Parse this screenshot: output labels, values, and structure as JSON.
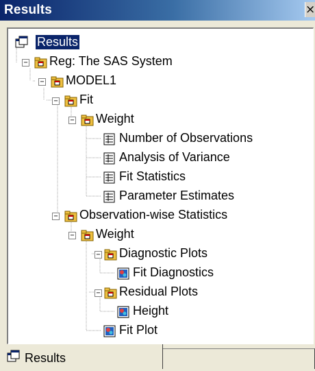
{
  "window": {
    "title": "Results",
    "close_glyph": "×"
  },
  "tree": {
    "root": "Results",
    "reg": "Reg:  The SAS System",
    "model": "MODEL1",
    "fit": "Fit",
    "fit_weight": "Weight",
    "number_of_observations": "Number of Observations",
    "analysis_of_variance": "Analysis of Variance",
    "fit_statistics": "Fit Statistics",
    "parameter_estimates": "Parameter Estimates",
    "observation_wise": "Observation-wise Statistics",
    "obs_weight": "Weight",
    "diagnostic_plots": "Diagnostic Plots",
    "fit_diagnostics": "Fit Diagnostics",
    "residual_plots": "Residual Plots",
    "height": "Height",
    "fit_plot": "Fit Plot"
  },
  "tabs": {
    "active": "Results"
  },
  "colors": {
    "selection": "#0a246a",
    "folder": "#f0c040",
    "tree_line": "#a0a0a0"
  },
  "icons": [
    "results-window-icon",
    "folder-icon",
    "table-icon",
    "graph-icon"
  ]
}
